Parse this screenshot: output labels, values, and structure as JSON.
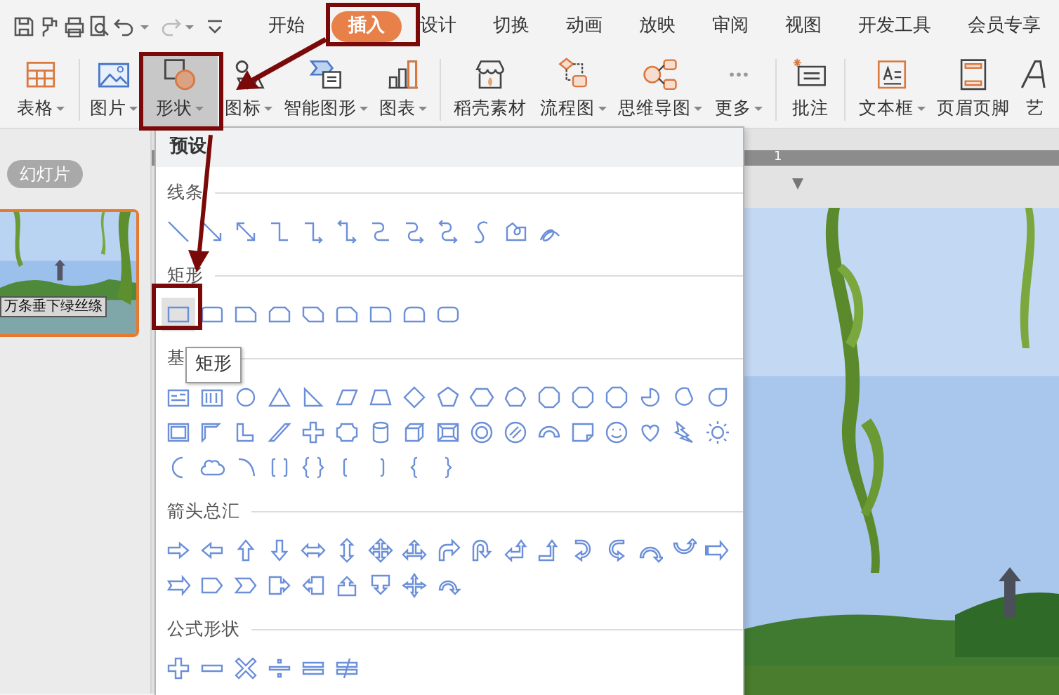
{
  "tabs": [
    {
      "label": "开始",
      "selected": false
    },
    {
      "label": "插入",
      "selected": true
    },
    {
      "label": "设计",
      "selected": false
    },
    {
      "label": "切换",
      "selected": false
    },
    {
      "label": "动画",
      "selected": false
    },
    {
      "label": "放映",
      "selected": false
    },
    {
      "label": "审阅",
      "selected": false
    },
    {
      "label": "视图",
      "selected": false
    },
    {
      "label": "开发工具",
      "selected": false
    },
    {
      "label": "会员专享",
      "selected": false
    }
  ],
  "ribbon": [
    {
      "label": "表格",
      "dropdown": true,
      "selected": false
    },
    {
      "label": "图片",
      "dropdown": true,
      "selected": false
    },
    {
      "label": "形状",
      "dropdown": true,
      "selected": true
    },
    {
      "label": "图标",
      "dropdown": true,
      "selected": false
    },
    {
      "label": "智能图形",
      "dropdown": true,
      "selected": false
    },
    {
      "label": "图表",
      "dropdown": true,
      "selected": false
    },
    {
      "label": "稻壳素材",
      "dropdown": false,
      "selected": false
    },
    {
      "label": "流程图",
      "dropdown": true,
      "selected": false
    },
    {
      "label": "思维导图",
      "dropdown": true,
      "selected": false
    },
    {
      "label": "更多",
      "dropdown": true,
      "selected": false
    },
    {
      "label": "批注",
      "dropdown": false,
      "selected": false
    },
    {
      "label": "文本框",
      "dropdown": true,
      "selected": false
    },
    {
      "label": "页眉页脚",
      "dropdown": false,
      "selected": false
    },
    {
      "label": "艺",
      "dropdown": false,
      "selected": false
    }
  ],
  "slides_panel": {
    "label": "幻灯片",
    "thumbnails": [
      {
        "caption": "万条垂下绿丝绦",
        "selected": true
      }
    ]
  },
  "shape_menu": {
    "header": "预设",
    "tooltip": "矩形",
    "sections": [
      {
        "title": "线条",
        "first_item_hovered": false
      },
      {
        "title": "矩形",
        "first_item_hovered": true
      },
      {
        "title": "基",
        "first_item_hovered": false
      },
      {
        "title": "箭头总汇",
        "first_item_hovered": false
      },
      {
        "title": "公式形状",
        "first_item_hovered": false
      }
    ]
  },
  "ruler": {
    "mark": "1"
  }
}
